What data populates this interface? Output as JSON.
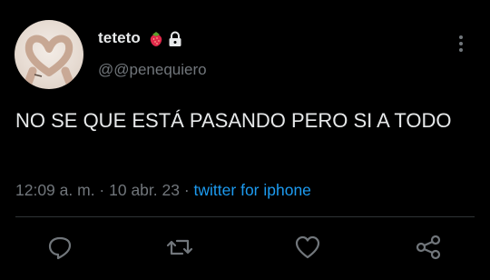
{
  "profile": {
    "display_name": "teteto",
    "emoji_icon": "strawberry-icon",
    "lock_icon": "lock-icon",
    "handle": "@@penequiero"
  },
  "tweet": {
    "text": "NO SE QUE ESTÁ PASANDO PERO SI A TODO"
  },
  "meta": {
    "time": "12:09 a. m.",
    "separator1": " · ",
    "date": "10 abr. 23",
    "separator2": " · ",
    "source": "twitter for iphone"
  },
  "actions": [
    "reply-icon",
    "retweet-icon",
    "like-icon",
    "share-icon"
  ],
  "colors": {
    "background": "#000000",
    "text": "#e7e9ea",
    "muted": "#71767b",
    "link": "#1d9bf0"
  }
}
